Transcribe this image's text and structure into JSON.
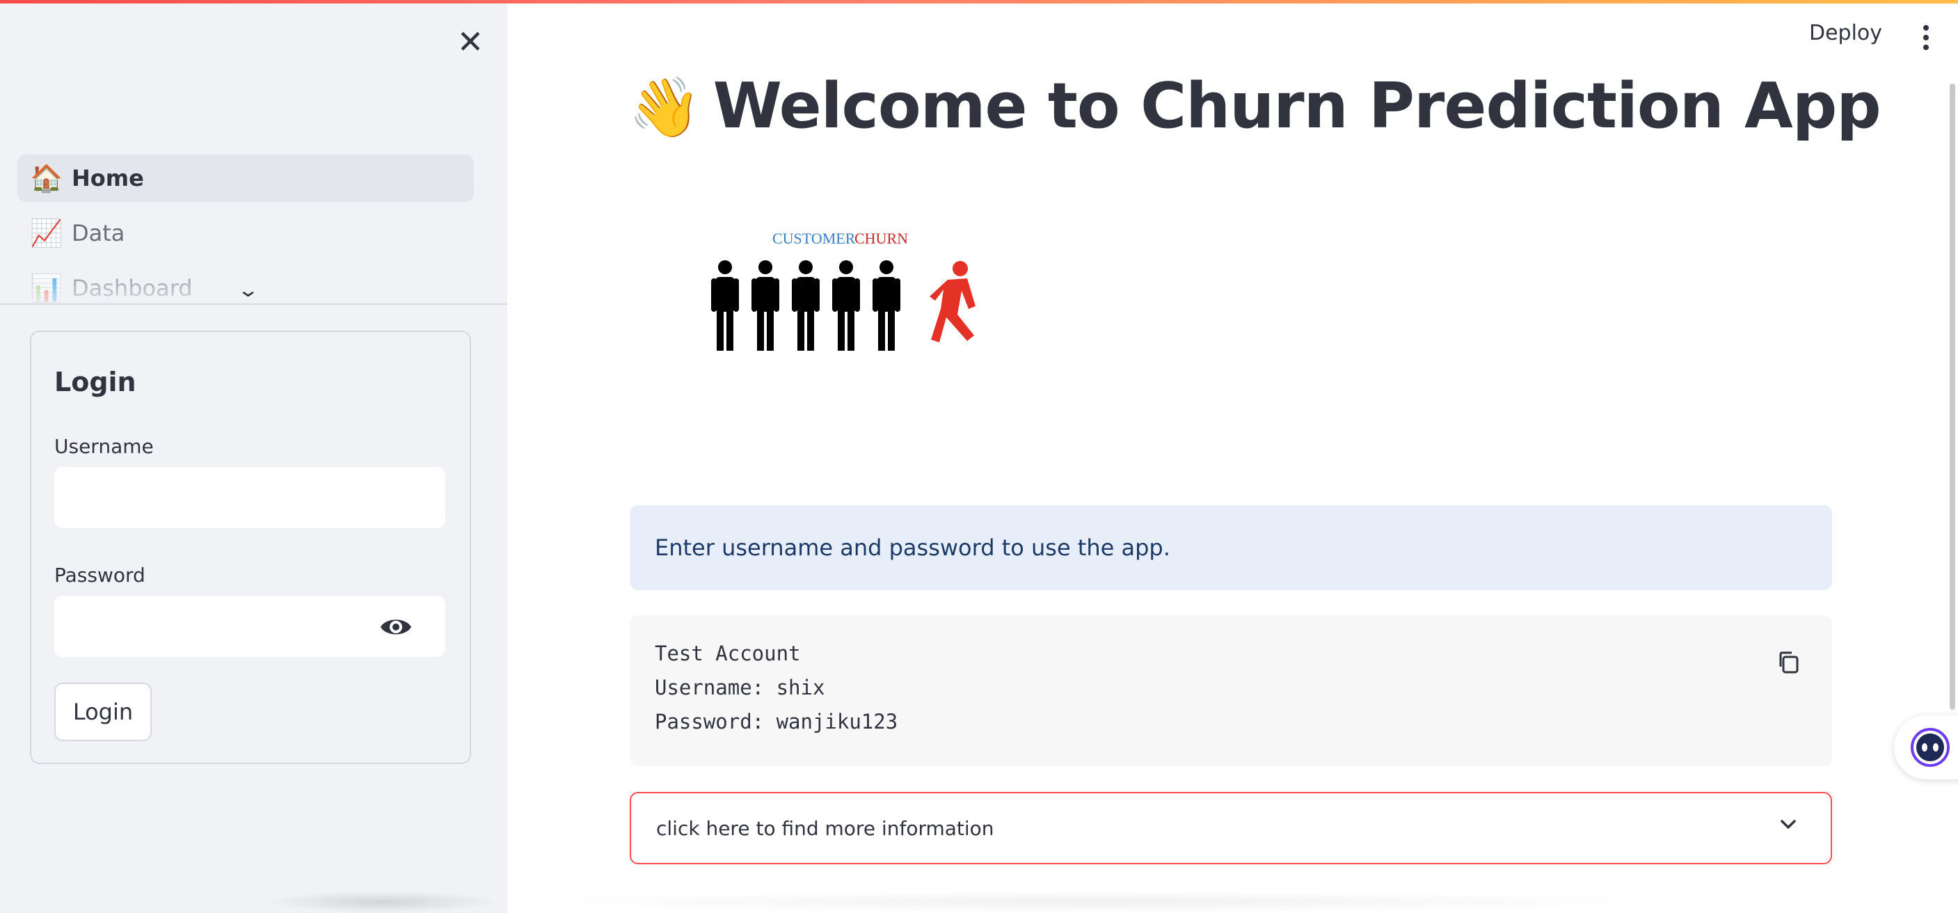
{
  "sidebar": {
    "nav_items": [
      {
        "icon": "🏠",
        "label": "Home",
        "active": true
      },
      {
        "icon": "📈",
        "label": "Data",
        "active": false
      },
      {
        "icon": "📊",
        "label": "Dashboard",
        "active": false
      }
    ],
    "login": {
      "title": "Login",
      "username_label": "Username",
      "username_value": "",
      "password_label": "Password",
      "password_value": "",
      "button_label": "Login"
    }
  },
  "header": {
    "deploy_label": "Deploy"
  },
  "main": {
    "title_emoji": "👋",
    "title": "Welcome to Churn Prediction App",
    "image": {
      "caption_customer": "CUSTOMER",
      "caption_churn": "CHURN"
    },
    "info_message": "Enter username and password to use the app.",
    "code_lines": [
      "Test Account",
      "Username: shix",
      "Password: wanjiku123"
    ],
    "expander_label": "click here to find more information"
  },
  "colors": {
    "accent": "#ff4b4b",
    "sidebar_bg": "#f0f2f6",
    "info_bg": "#e8eef9",
    "text": "#31333f"
  },
  "icons": {
    "close": "close-icon",
    "eye": "eye-icon",
    "copy": "copy-icon",
    "chevron": "chevron-down-icon",
    "menu": "kebab-menu-icon"
  }
}
